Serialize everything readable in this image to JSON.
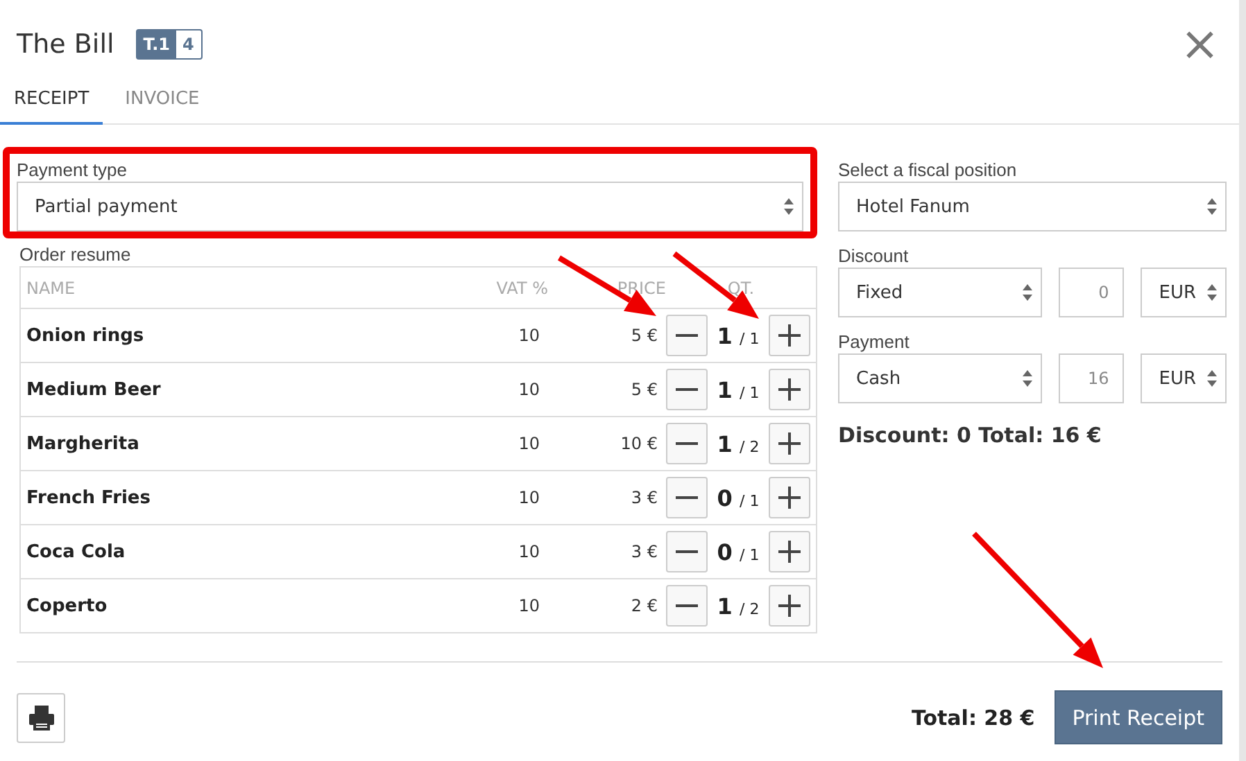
{
  "dialog": {
    "title": "The Bill",
    "table_badge": "T.1",
    "guests_badge": "4",
    "close": "×"
  },
  "tabs": [
    {
      "label": "RECEIPT",
      "selected": true
    },
    {
      "label": "INVOICE",
      "selected": false
    }
  ],
  "payment_type": {
    "label": "Payment type",
    "value": "Partial payment",
    "highlighted": true
  },
  "order": {
    "label": "Order resume",
    "columns": [
      "NAME",
      "VAT %",
      "PRICE",
      "QT."
    ],
    "rows": [
      {
        "name": "Onion rings",
        "vat": "10",
        "price": "5 €",
        "qty": "1",
        "of": "/ 1"
      },
      {
        "name": "Medium Beer",
        "vat": "10",
        "price": "5 €",
        "qty": "1",
        "of": "/ 1"
      },
      {
        "name": "Margherita",
        "vat": "10",
        "price": "10 €",
        "qty": "1",
        "of": "/ 2"
      },
      {
        "name": "French Fries",
        "vat": "10",
        "price": "3 €",
        "qty": "0",
        "of": "/ 1"
      },
      {
        "name": "Coca Cola",
        "vat": "10",
        "price": "3 €",
        "qty": "0",
        "of": "/ 1"
      },
      {
        "name": "Coperto",
        "vat": "10",
        "price": "2 €",
        "qty": "1",
        "of": "/ 2"
      }
    ]
  },
  "fiscal_position": {
    "label": "Select a fiscal position",
    "value": "Hotel Fanum"
  },
  "discount": {
    "label": "Discount",
    "type": "Fixed",
    "amount": "0",
    "currency": "EUR"
  },
  "payment": {
    "label": "Payment",
    "method": "Cash",
    "amount": "16",
    "currency": "EUR"
  },
  "summary": "Discount: 0 Total: 16 €",
  "footer": {
    "total": "Total: 28 €",
    "button": "Print Receipt"
  }
}
